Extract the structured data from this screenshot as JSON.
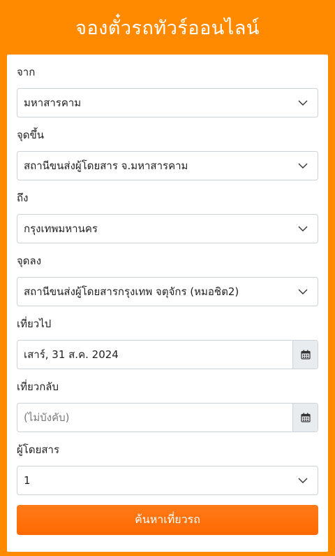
{
  "header": {
    "title": "จองตั๋วรถทัวร์ออนไลน์"
  },
  "form": {
    "origin": {
      "label": "จาก",
      "value": "มหาสารคาม"
    },
    "boarding": {
      "label": "จุดขึ้น",
      "value": "สถานีขนส่งผู้โดยสาร จ.มหาสารคาม"
    },
    "destination": {
      "label": "ถึง",
      "value": "กรุงเทพมหานคร"
    },
    "dropoff": {
      "label": "จุดลง",
      "value": "สถานีขนส่งผู้โดยสารกรุงเทพ จตุจักร (หมอชิต2)"
    },
    "depart": {
      "label": "เที่ยวไป",
      "value": "เสาร์, 31 ส.ค. 2024"
    },
    "return": {
      "label": "เที่ยวกลับ",
      "placeholder": "(ไม่บังคับ)"
    },
    "passengers": {
      "label": "ผู้โดยสาร",
      "value": "1"
    },
    "search_label": "ค้นหาเที่ยวรถ"
  },
  "icons": {
    "select": "chevron-down-icon",
    "calendar": "calendar-icon"
  },
  "colors": {
    "brand": "#ff8a00",
    "button": "#ff6a00"
  }
}
